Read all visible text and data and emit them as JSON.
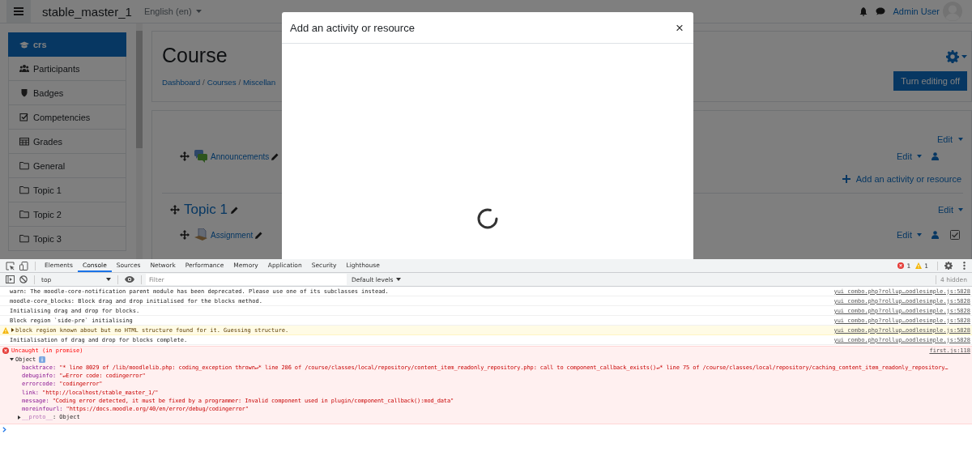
{
  "navbar": {
    "site_name": "stable_master_1",
    "language": "English (en)",
    "user_name": "Admin User"
  },
  "drawer": {
    "items": [
      {
        "label": "crs",
        "kind": "course",
        "selected": true
      },
      {
        "label": "Participants",
        "kind": "participants",
        "selected": false
      },
      {
        "label": "Badges",
        "kind": "badges",
        "selected": false
      },
      {
        "label": "Competencies",
        "kind": "competencies",
        "selected": false
      },
      {
        "label": "Grades",
        "kind": "grades",
        "selected": false
      },
      {
        "label": "General",
        "kind": "section",
        "selected": false
      },
      {
        "label": "Topic 1",
        "kind": "section",
        "selected": false
      },
      {
        "label": "Topic 2",
        "kind": "section",
        "selected": false
      },
      {
        "label": "Topic 3",
        "kind": "section",
        "selected": false
      }
    ]
  },
  "page_header": {
    "title": "Course",
    "breadcrumb": [
      "Dashboard",
      "Courses",
      "Miscellan"
    ],
    "separator": "/",
    "button": "Turn editing off"
  },
  "course_content": {
    "general": {
      "edit": "Edit",
      "activities": [
        {
          "name": "Announcements",
          "kind": "forum",
          "edit": "Edit"
        }
      ],
      "add_link": "Add an activity or resource"
    },
    "topic": {
      "title": "Topic 1",
      "edit": "Edit",
      "activities": [
        {
          "name": "Assignment",
          "kind": "assign",
          "edit": "Edit",
          "checked": true
        }
      ]
    }
  },
  "modal": {
    "title": "Add an activity or resource",
    "close": "×",
    "loading": true
  },
  "devtools": {
    "tabs": [
      {
        "label": "Elements",
        "selected": false
      },
      {
        "label": "Console",
        "selected": true
      },
      {
        "label": "Sources",
        "selected": false
      },
      {
        "label": "Network",
        "selected": false
      },
      {
        "label": "Performance",
        "selected": false
      },
      {
        "label": "Memory",
        "selected": false
      },
      {
        "label": "Application",
        "selected": false
      },
      {
        "label": "Security",
        "selected": false
      },
      {
        "label": "Lighthouse",
        "selected": false
      }
    ],
    "error_count": "1",
    "warning_count": "1",
    "context": "top",
    "filter_placeholder": "Filter",
    "levels": "Default levels",
    "hidden": "4 hidden",
    "messages": [
      {
        "kind": "log",
        "text": "warn: The moodle-core-notification parent module has been deprecated. Please use one of its subclasses instead.",
        "source": "yui_combo.php?rollup…oodlesimple.js:5828"
      },
      {
        "kind": "log",
        "text": "moodle-core_blocks: Block drag and drop initialised for the blocks method.",
        "source": "yui_combo.php?rollup…oodlesimple.js:5828"
      },
      {
        "kind": "log",
        "text": "Initialising drag and drop for blocks.",
        "source": "yui_combo.php?rollup…oodlesimple.js:5828"
      },
      {
        "kind": "log",
        "text": "Block region `side-pre` initialising",
        "source": "yui_combo.php?rollup…oodlesimple.js:5828"
      },
      {
        "kind": "warning",
        "text": "block region known about but no HTML structure found for it. Guessing structure.",
        "source": "yui_combo.php?rollup…oodlesimple.js:5828",
        "expanded": false
      },
      {
        "kind": "log",
        "text": "Initialisation of drag and drop for blocks complete.",
        "source": "yui_combo.php?rollup…oodlesimple.js:5828"
      },
      {
        "kind": "error",
        "text": "Uncaught (in promise)",
        "source": "first.js:118",
        "object": {
          "label": "Object",
          "expanded": true,
          "properties": [
            {
              "key": "backtrace:",
              "value": "\"* line 8029 of /lib/moodlelib.php: coding_exception thrown↵* line 286 of /course/classes/local/repository/content_item_readonly_repository.php: call to component_callback_exists()↵* line 75 of /course/classes/local/repository/caching_content_item_readonly_repository…"
            },
            {
              "key": "debuginfo:",
              "value": "\"↵Error code: codingerror\""
            },
            {
              "key": "errorcode:",
              "value": "\"codingerror\""
            },
            {
              "key": "link:",
              "value": "\"http://localhost/stable_master_1/\""
            },
            {
              "key": "message:",
              "value": "\"Coding error detected, it must be fixed by a programmer: Invalid component used in plugin/component_callback():mod_data\""
            },
            {
              "key": "moreinfourl:",
              "value": "\"https://docs.moodle.org/40/en/error/debug/codingerror\""
            }
          ],
          "proto_key": "__proto__",
          "proto_value": ": Object",
          "proto_expanded": false
        }
      }
    ]
  }
}
